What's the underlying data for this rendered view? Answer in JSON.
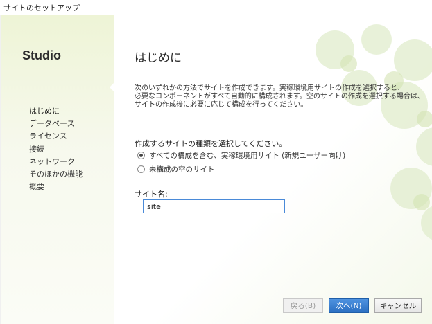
{
  "window": {
    "title": "サイトのセットアップ"
  },
  "sidebar": {
    "brand": "Studio",
    "items": [
      {
        "label": "はじめに",
        "active": true
      },
      {
        "label": "データベース"
      },
      {
        "label": "ライセンス"
      },
      {
        "label": "接続"
      },
      {
        "label": "ネットワーク"
      },
      {
        "label": "そのほかの機能"
      },
      {
        "label": "概要"
      }
    ]
  },
  "main": {
    "title": "はじめに",
    "intro_lines": [
      "次のいずれかの方法でサイトを作成できます。実稼環境用サイトの作成を選択すると、",
      "必要なコンポーネントがすべて自動的に構成されます。空のサイトの作成を選択する場合は、",
      "サイトの作成後に必要に応じて構成を行ってください。"
    ],
    "site_type_label": "作成するサイトの種類を選択してください。",
    "options": [
      {
        "label": "すべての構成を含む、実稼環境用サイト (新規ユーザー向け)",
        "selected": true
      },
      {
        "label": "未構成の空のサイト",
        "selected": false
      }
    ],
    "site_name_label": "サイト名:",
    "site_name_value": "site"
  },
  "footer": {
    "back_label": "戻る(B)",
    "next_label": "次へ(N)",
    "cancel_label": "キャンセル"
  },
  "colors": {
    "accent": "#2b6fc2",
    "sidebar_bg": "#eef4d6",
    "deco": "#d9e8b8"
  }
}
